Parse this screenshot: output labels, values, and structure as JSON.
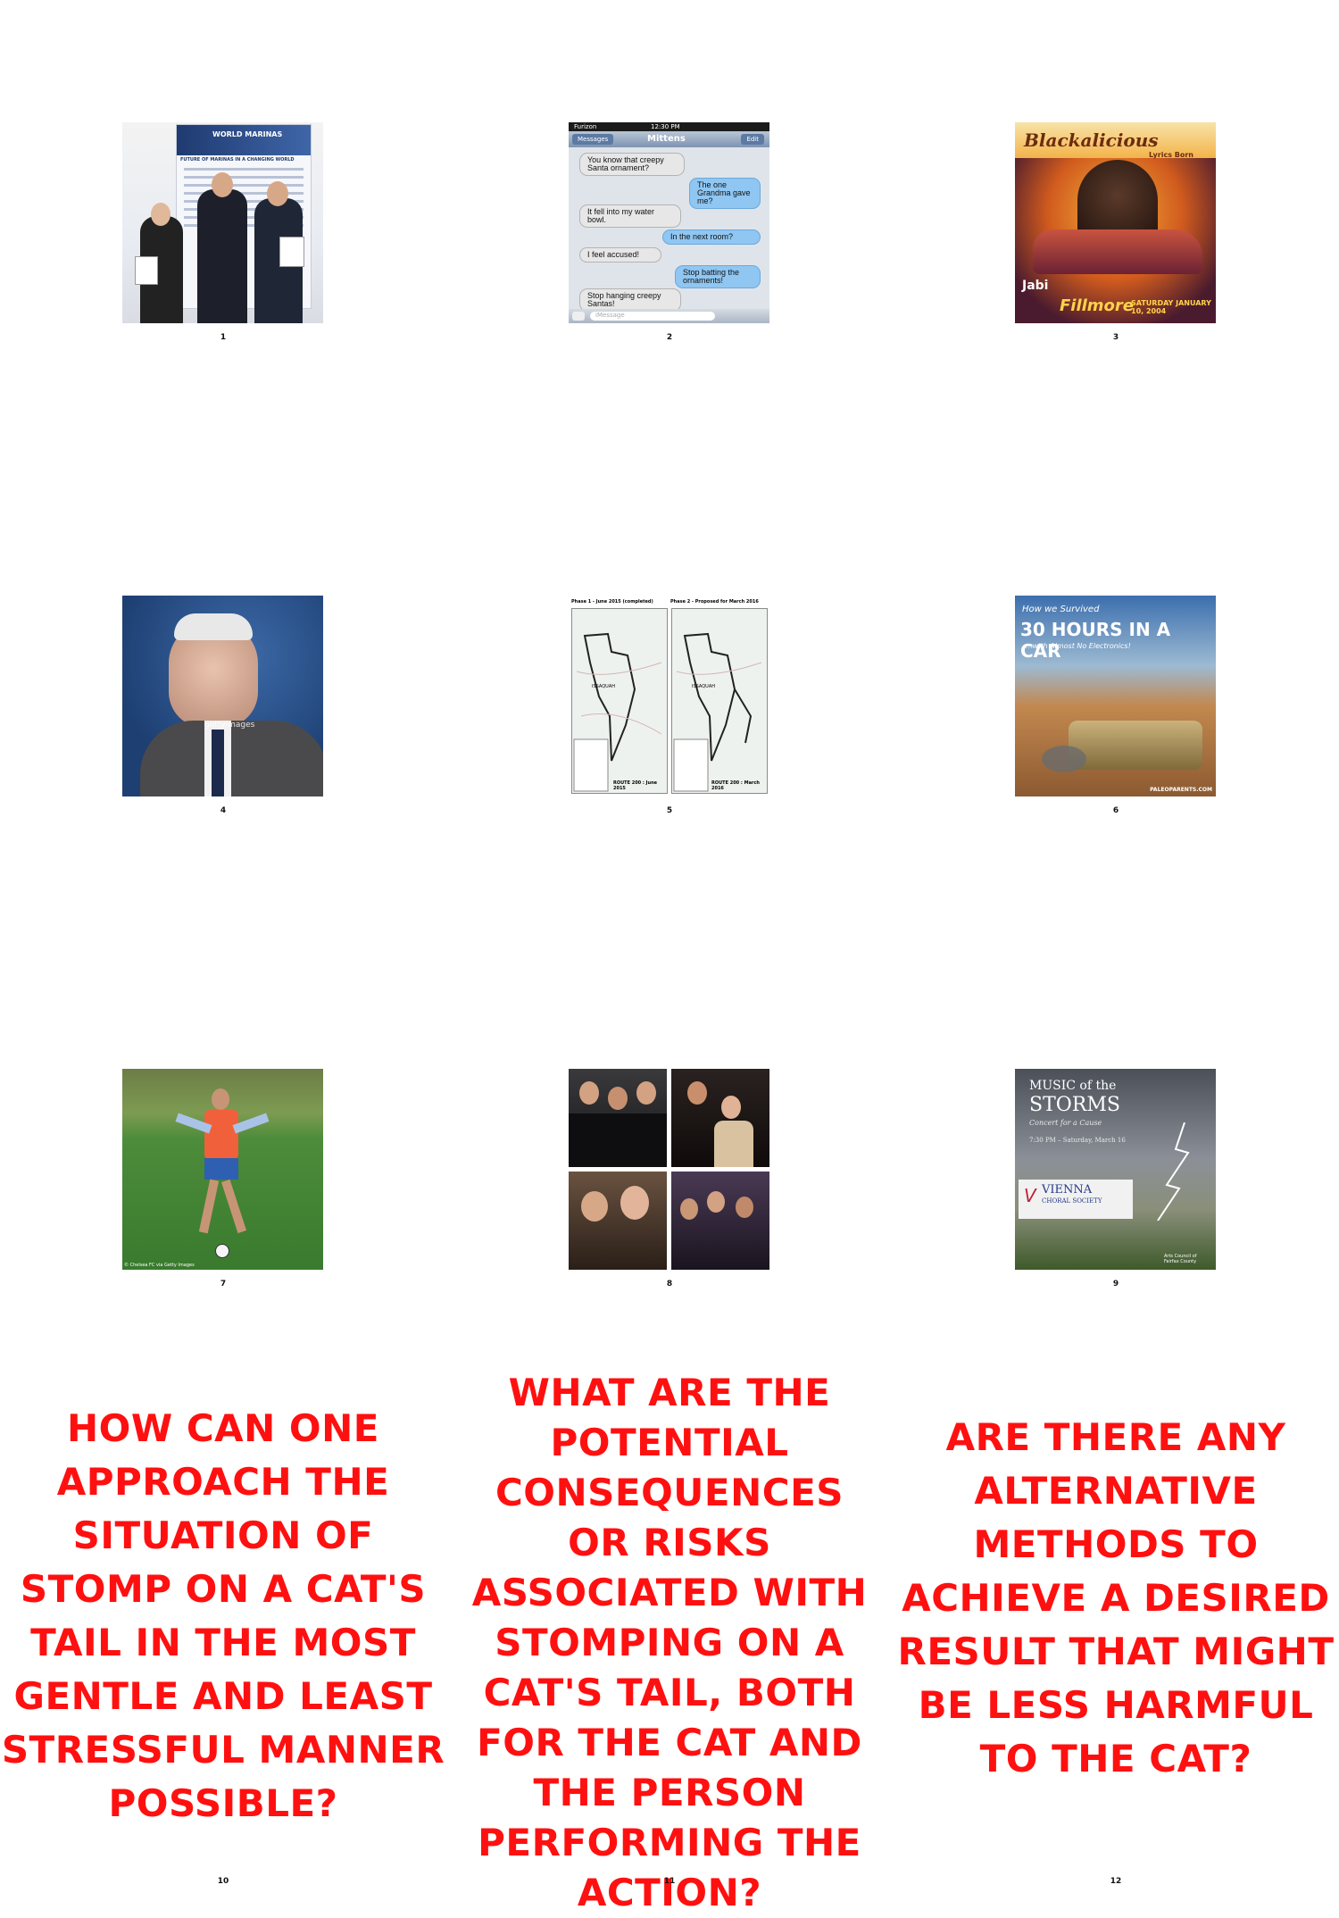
{
  "numbers": [
    "1",
    "2",
    "3",
    "4",
    "5",
    "6",
    "7",
    "8",
    "9",
    "10",
    "11",
    "12"
  ],
  "thumb1": {
    "poster_title": "WORLD MARINAS",
    "poster_sub": "FUTURE OF MARINAS IN A CHANGING WORLD"
  },
  "thumb2": {
    "carrier": "Furizon",
    "time": "12:30 PM",
    "back": "Messages",
    "contact": "Mittens",
    "edit": "Edit",
    "messages": [
      {
        "side": "l",
        "text": "You know that creepy Santa ornament?"
      },
      {
        "side": "r",
        "text": "The one Grandma gave me?"
      },
      {
        "side": "l",
        "text": "It fell into my water bowl."
      },
      {
        "side": "r",
        "text": "In the next room?"
      },
      {
        "side": "l",
        "text": "I feel accused!"
      },
      {
        "side": "r",
        "text": "Stop batting the ornaments!"
      },
      {
        "side": "l",
        "text": "Stop hanging creepy Santas!"
      }
    ],
    "input_placeholder": "iMessage"
  },
  "thumb3": {
    "title": "Blackalicious",
    "sub": "Lyrics Born",
    "venue": "Fillmore",
    "date": "SATURDAY JANUARY 10, 2004",
    "extra": "Jabi"
  },
  "thumb4": {
    "watermark": "gettyimages"
  },
  "thumb5": {
    "left_title": "Phase 1 - June 2015 (completed)",
    "right_title": "Phase 2 - Proposed for March 2016",
    "left_footer": "ROUTE 200 : June 2015",
    "right_footer": "ROUTE 200 : March 2016",
    "label": "ISSAQUAH"
  },
  "thumb6": {
    "line1": "How we Survived",
    "line2": "30 HOURS IN A CAR",
    "line3": "...with Almost No Electronics!",
    "credit": "PALEOPARENTS.COM"
  },
  "thumb7": {
    "credit": "© Chelsea FC via Getty Images"
  },
  "thumb9": {
    "title1": "MUSIC of the",
    "title2": "STORMS",
    "sub": "Concert for a Cause",
    "when": "7:30 PM – Saturday, March 16",
    "org": "VIENNA",
    "org2": "CHORAL SOCIETY",
    "sponsor": "Arts Council of Fairfax County"
  },
  "captions": [
    "How can one approach the situation of stomp on a cat's tail in the most gentle and least stressful manner possible?",
    "What are the potential consequences or risks associated with stomping on a cat's tail, both for the cat and the person performing the action?",
    "Are there any alternative methods to achieve a desired result that might be less harmful to the cat?"
  ],
  "colors": {
    "caption": "#ff1010"
  }
}
